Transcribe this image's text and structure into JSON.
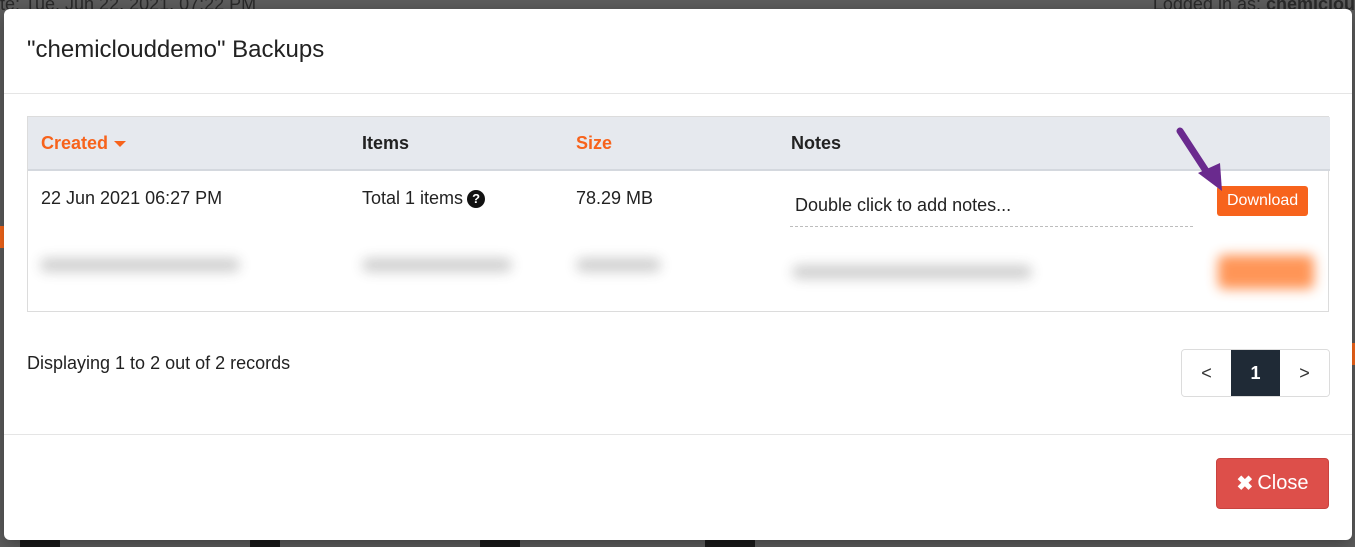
{
  "background": {
    "top_left_text": "te: Tue, Jun 22, 2021, 07:22 PM",
    "top_right_prefix": "Logged in as: ",
    "top_right_user": "chemiclou"
  },
  "modal": {
    "title": "\"chemiclouddemo\" Backups",
    "table": {
      "headers": {
        "created": "Created",
        "items": "Items",
        "size": "Size",
        "notes": "Notes"
      },
      "rows": [
        {
          "created": "22 Jun 2021 06:27 PM",
          "items": "Total 1 items",
          "size": "78.29 MB",
          "notes_placeholder": "Double click to add notes...",
          "download_label": "Download"
        }
      ]
    },
    "records_text": "Displaying 1 to 2 out of 2 records",
    "pagination": {
      "prev": "<",
      "current": "1",
      "next": ">"
    },
    "close_label": "Close"
  },
  "colors": {
    "accent_orange": "#f7631c",
    "close_red": "#dd4f4a",
    "pager_active": "#1f2a36",
    "arrow_purple": "#6a2a8e"
  }
}
